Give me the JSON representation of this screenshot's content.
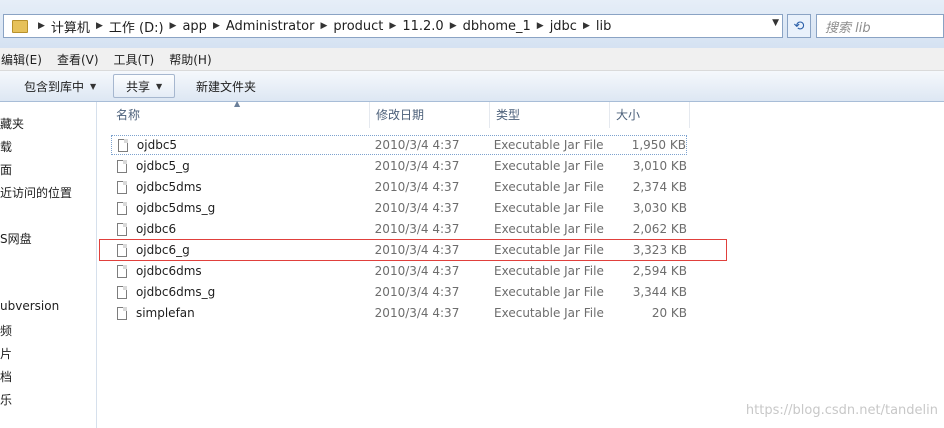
{
  "address": {
    "crumbs": [
      "计算机",
      "工作 (D:)",
      "app",
      "Administrator",
      "product",
      "11.2.0",
      "dbhome_1",
      "jdbc",
      "lib"
    ]
  },
  "search": {
    "placeholder": "搜索 lib"
  },
  "menu": [
    "编辑(E)",
    "查看(V)",
    "工具(T)",
    "帮助(H)"
  ],
  "toolbar": {
    "include_label": "包含到库中",
    "share_label": "共享",
    "new_folder_label": "新建文件夹"
  },
  "nav": [
    "藏夹",
    "载",
    "面",
    "近访问的位置",
    "S网盘",
    "ubversion",
    "频",
    "片",
    "档",
    "乐"
  ],
  "columns": {
    "name": "名称",
    "date": "修改日期",
    "type": "类型",
    "size": "大小"
  },
  "files": [
    {
      "name": "ojdbc5",
      "date": "2010/3/4 4:37",
      "type": "Executable Jar File",
      "size": "1,950 KB"
    },
    {
      "name": "ojdbc5_g",
      "date": "2010/3/4 4:37",
      "type": "Executable Jar File",
      "size": "3,010 KB"
    },
    {
      "name": "ojdbc5dms",
      "date": "2010/3/4 4:37",
      "type": "Executable Jar File",
      "size": "2,374 KB"
    },
    {
      "name": "ojdbc5dms_g",
      "date": "2010/3/4 4:37",
      "type": "Executable Jar File",
      "size": "3,030 KB"
    },
    {
      "name": "ojdbc6",
      "date": "2010/3/4 4:37",
      "type": "Executable Jar File",
      "size": "2,062 KB"
    },
    {
      "name": "ojdbc6_g",
      "date": "2010/3/4 4:37",
      "type": "Executable Jar File",
      "size": "3,323 KB"
    },
    {
      "name": "ojdbc6dms",
      "date": "2010/3/4 4:37",
      "type": "Executable Jar File",
      "size": "2,594 KB"
    },
    {
      "name": "ojdbc6dms_g",
      "date": "2010/3/4 4:37",
      "type": "Executable Jar File",
      "size": "3,344 KB"
    },
    {
      "name": "simplefan",
      "date": "2010/3/4 4:37",
      "type": "Executable Jar File",
      "size": "20 KB"
    }
  ],
  "watermark": "https://blog.csdn.net/tandelin",
  "colors": {
    "highlight": "#e0403c",
    "accent": "#2a5ea8"
  }
}
